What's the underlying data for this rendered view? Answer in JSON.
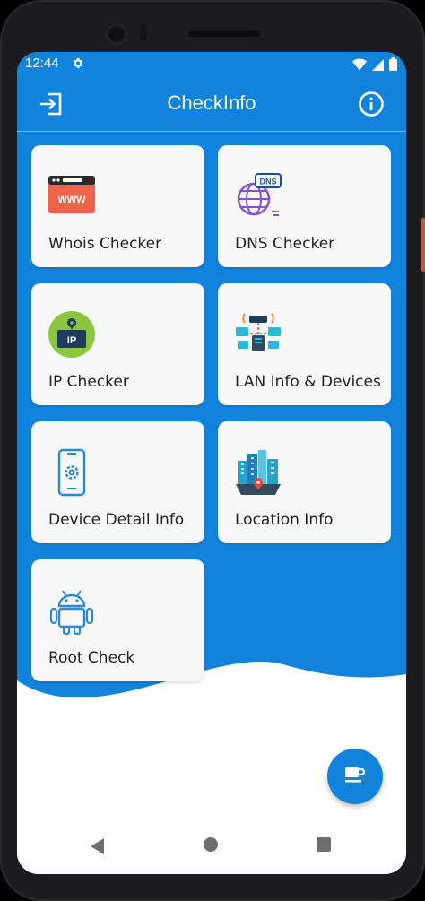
{
  "status_bar": {
    "time": "12:44",
    "icons": [
      "gear-icon",
      "wifi-icon",
      "signal-icon",
      "battery-icon"
    ]
  },
  "app_bar": {
    "title": "CheckInfo",
    "left_icon": "exit-icon",
    "right_icon": "info-icon"
  },
  "cards": [
    {
      "label": "Whois Checker",
      "icon": "www-browser-icon"
    },
    {
      "label": "DNS Checker",
      "icon": "dns-globe-icon"
    },
    {
      "label": "IP Checker",
      "icon": "ip-location-icon"
    },
    {
      "label": "LAN Info & Devices",
      "icon": "lan-network-icon"
    },
    {
      "label": "Device Detail Info",
      "icon": "phone-settings-icon"
    },
    {
      "label": "Location Info",
      "icon": "city-location-icon"
    },
    {
      "label": "Root Check",
      "icon": "android-icon"
    }
  ],
  "fab": {
    "icon": "coffee-cup-icon"
  },
  "nav": {
    "icons": [
      "back-icon",
      "home-icon",
      "recents-icon"
    ]
  },
  "colors": {
    "primary": "#1183dd",
    "card": "#f8f8f8",
    "www_red": "#f0624a",
    "ip_green": "#8cc63e",
    "dark_navy": "#1f3a5a"
  }
}
